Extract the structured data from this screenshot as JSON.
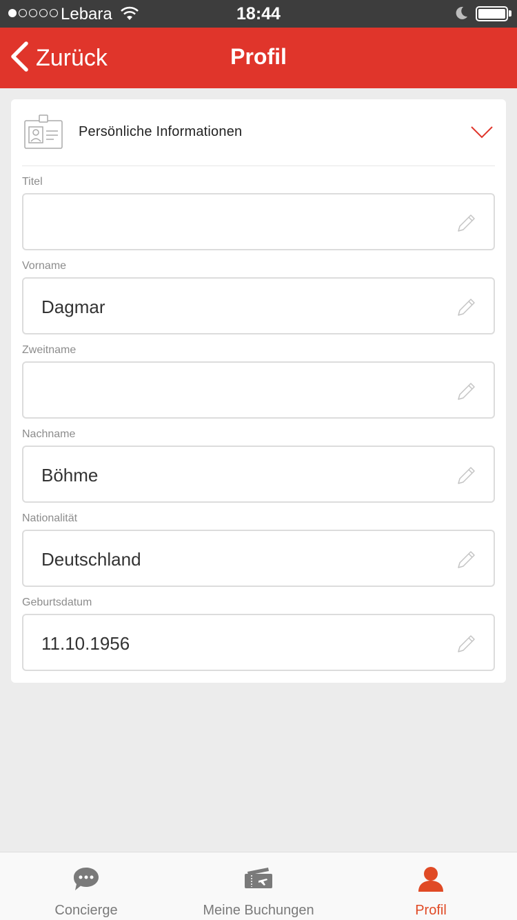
{
  "status_bar": {
    "carrier": "Lebara",
    "time": "18:44",
    "signal_bars_filled": 1,
    "signal_bars_total": 5,
    "battery_level": 1.0
  },
  "nav": {
    "back_label": "Zurück",
    "title": "Profil"
  },
  "section": {
    "title": "Persönliche Informationen",
    "icon": "id-card-icon",
    "chevron_color": "#e0352b"
  },
  "fields": [
    {
      "label": "Titel",
      "value": ""
    },
    {
      "label": "Vorname",
      "value": "Dagmar"
    },
    {
      "label": "Zweitname",
      "value": ""
    },
    {
      "label": "Nachname",
      "value": "Böhme"
    },
    {
      "label": "Nationalität",
      "value": "Deutschland"
    },
    {
      "label": "Geburtsdatum",
      "value": "11.10.1956"
    }
  ],
  "tabs": [
    {
      "label": "Concierge",
      "icon": "chat-bubble-icon",
      "active": false
    },
    {
      "label": "Meine Buchungen",
      "icon": "ticket-icon",
      "active": false
    },
    {
      "label": "Profil",
      "icon": "person-icon",
      "active": true
    }
  ],
  "colors": {
    "brand_red": "#e0352b",
    "active_tab": "#e04a25",
    "inactive_tab": "#7a7a7a",
    "background": "#ececec"
  }
}
